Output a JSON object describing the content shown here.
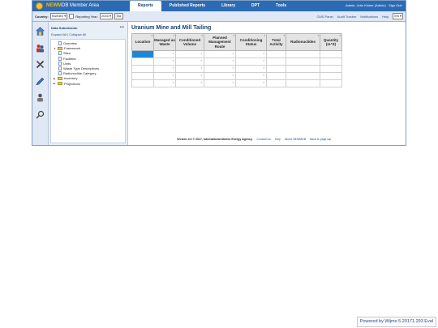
{
  "app": {
    "brand": "NEWM",
    "title_rest": "DB Member Area"
  },
  "nav": {
    "tabs": [
      {
        "label": "Reports",
        "active": true
      },
      {
        "label": "Published Reports",
        "active": false
      },
      {
        "label": "Library",
        "active": false
      },
      {
        "label": "DPT",
        "active": false
      },
      {
        "label": "Tools",
        "active": false
      }
    ]
  },
  "user": {
    "text": "Admin: John Kinker (Admin)",
    "signout": "Sign Out"
  },
  "filters": {
    "country_label": "Country:",
    "country_value": "Sweden",
    "year_label": "Reporting Year:",
    "year_value": "2016",
    "go_label": "Go"
  },
  "links": {
    "cms": "CMS Panel",
    "audit": "Audit Tracker",
    "notifications": "Notifications",
    "help": "Help",
    "lang": "EN"
  },
  "tree": {
    "title": "Data Submission",
    "menu": "•••",
    "expand_all": "Expand All",
    "separator": "|",
    "collapse_all": "Collapse All",
    "nodes": [
      {
        "label": "Overview",
        "type": "doc",
        "level": 1
      },
      {
        "label": "Framework",
        "type": "folder",
        "level": 0,
        "toggle": "▼"
      },
      {
        "label": "Sites",
        "type": "doc",
        "level": 1
      },
      {
        "label": "Facilities",
        "type": "doc",
        "level": 1
      },
      {
        "label": "Units",
        "type": "doc",
        "level": 1
      },
      {
        "label": "Waste Type Descriptions",
        "type": "doc",
        "level": 1
      },
      {
        "label": "Radionuclide Category",
        "type": "doc",
        "level": 1
      },
      {
        "label": "Inventory",
        "type": "folder",
        "level": 0,
        "toggle": "▶"
      },
      {
        "label": "Projections",
        "type": "folder",
        "level": 0,
        "toggle": "▶"
      }
    ]
  },
  "main": {
    "title": "Uranium Mine and Mill Tailing",
    "columns": [
      {
        "label": "Location",
        "width": 26
      },
      {
        "label": "Managed as Waste",
        "width": 26
      },
      {
        "label": "Conditioned Volume",
        "width": 34
      },
      {
        "label": "Planned Management Route",
        "width": 38
      },
      {
        "label": "Conditioning Status",
        "width": 37
      },
      {
        "label": "Total Activity",
        "width": 23
      },
      {
        "label": "Radionuclides",
        "width": 41
      },
      {
        "label": "Quantity (m^3)",
        "width": 26
      }
    ],
    "row_count": 5
  },
  "footer": {
    "version": "Version 4.0 © 2017, International Atomic Energy Agency.",
    "contact": "Contact Us",
    "help": "Help",
    "about": "About NEWMDB",
    "top": "Back to page top"
  },
  "powered": "Powered by Wijmo 5.20171.293 Eval"
}
